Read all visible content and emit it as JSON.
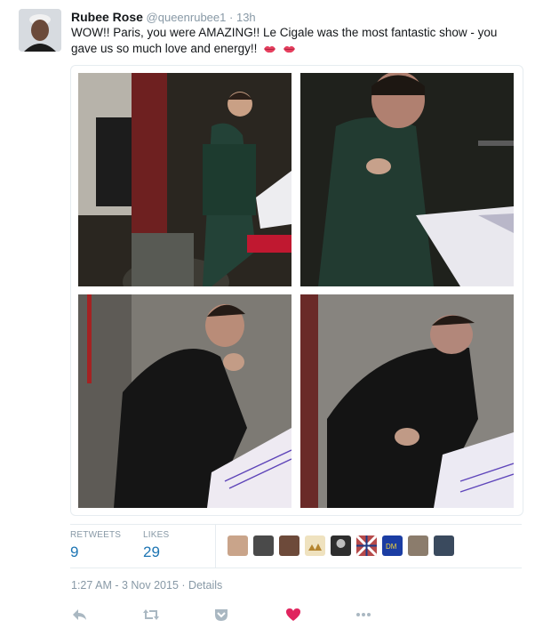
{
  "tweet": {
    "author_name": "Rubee Rose",
    "author_handle": "@queenrubee1",
    "separator": "·",
    "time_ago": "13h",
    "text": "WOW!! Paris, you were AMAZING!! Le Cigale was the most fantastic show - you gave us so much love and energy!!",
    "emoji": "kiss-mark-lips"
  },
  "stats": {
    "retweets_label": "RETWEETS",
    "retweets_count": "9",
    "likes_label": "LIKES",
    "likes_count": "29"
  },
  "meta": {
    "timestamp": "1:27 AM - 3 Nov 2015",
    "dot": "·",
    "details_link": "Details"
  },
  "actions": {
    "reply_icon": "reply-icon",
    "retweet_icon": "retweet-icon",
    "pocket_icon": "save-icon",
    "like_icon": "heart-icon",
    "more_icon": "more-icon"
  },
  "colors": {
    "link_blue": "#1d75b3",
    "muted": "#8899a6",
    "like_red": "#e0245e",
    "border": "#e6ecf0"
  }
}
